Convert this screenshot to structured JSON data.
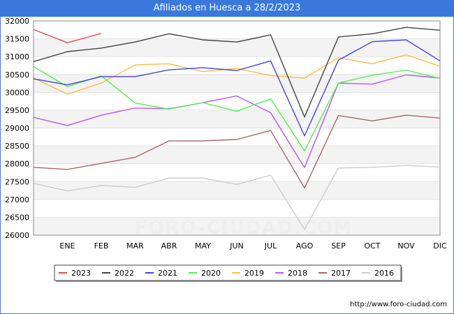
{
  "title": "Afiliados en Huesca a 28/2/2023",
  "watermark": "FORO-CIUDAD.COM",
  "footer_url": "http://www.foro-ciudad.com",
  "chart_data": {
    "type": "line",
    "title": "Afiliados en Huesca a 28/2/2023",
    "xlabel": "",
    "ylabel": "",
    "categories": [
      "",
      "ENE",
      "FEB",
      "MAR",
      "ABR",
      "MAY",
      "JUN",
      "JUL",
      "AGO",
      "SEP",
      "OCT",
      "NOV",
      "DIC"
    ],
    "ylim": [
      26000,
      32000
    ],
    "yticks": [
      26000,
      26500,
      27000,
      27500,
      28000,
      28500,
      29000,
      29500,
      30000,
      30500,
      31000,
      31500,
      32000
    ],
    "grid": "horizontal bands",
    "legend": "bottom",
    "series": [
      {
        "name": "2023",
        "color": "#e05050",
        "values": [
          31760,
          31390,
          31650
        ]
      },
      {
        "name": "2022",
        "color": "#444444",
        "values": [
          30860,
          31140,
          31240,
          31410,
          31640,
          31470,
          31410,
          31610,
          29310,
          31550,
          31640,
          31820,
          31740
        ]
      },
      {
        "name": "2021",
        "color": "#4444dd",
        "values": [
          30380,
          30210,
          30440,
          30440,
          30630,
          30690,
          30610,
          30880,
          28780,
          30900,
          31420,
          31470,
          30880
        ]
      },
      {
        "name": "2020",
        "color": "#55ee55",
        "values": [
          30720,
          30160,
          30460,
          29700,
          29530,
          29710,
          29470,
          29820,
          28360,
          30260,
          30480,
          30620,
          30390
        ]
      },
      {
        "name": "2019",
        "color": "#ffbb44",
        "values": [
          30400,
          29950,
          30260,
          30770,
          30800,
          30580,
          30670,
          30470,
          30400,
          30970,
          30800,
          31050,
          30730
        ]
      },
      {
        "name": "2018",
        "color": "#bb55ee",
        "values": [
          29300,
          29070,
          29360,
          29560,
          29540,
          29710,
          29900,
          29430,
          27890,
          30260,
          30230,
          30490,
          30400
        ]
      },
      {
        "name": "2017",
        "color": "#aa6666",
        "values": [
          27900,
          27840,
          28010,
          28180,
          28640,
          28640,
          28680,
          28930,
          27320,
          29350,
          29200,
          29360,
          29280
        ]
      },
      {
        "name": "2016",
        "color": "#cccccc",
        "values": [
          27450,
          27240,
          27390,
          27340,
          27600,
          27600,
          27420,
          27680,
          26160,
          27880,
          27900,
          27950,
          27910
        ]
      }
    ]
  }
}
